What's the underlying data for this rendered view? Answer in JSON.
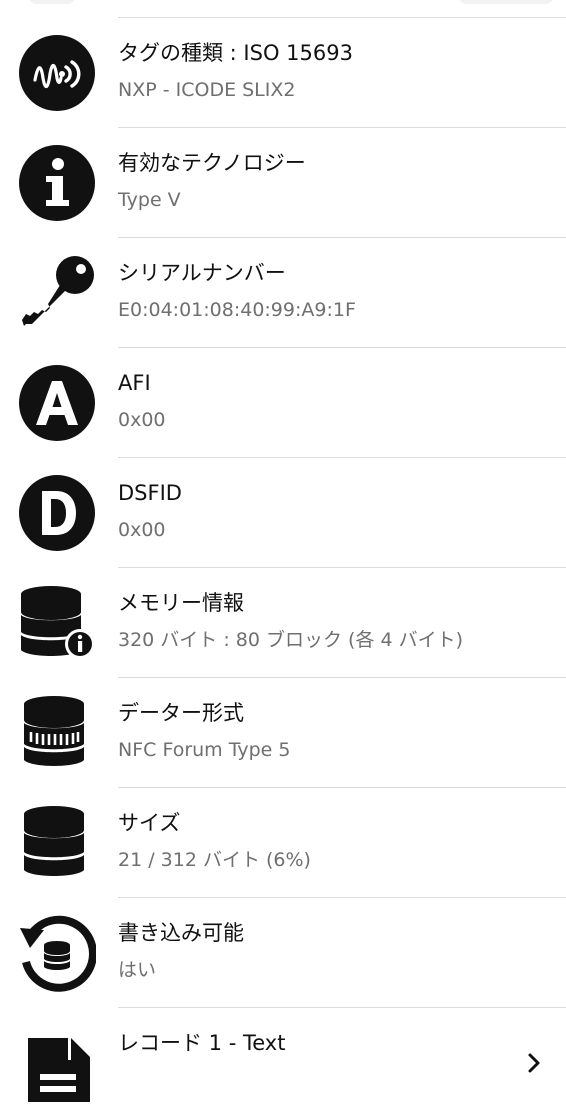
{
  "rows": [
    {
      "icon": "nfc-wave-icon",
      "title": "タグの種類 : ISO 15693",
      "value": "NXP - ICODE SLIX2"
    },
    {
      "icon": "info-icon",
      "title": "有効なテクノロジー",
      "value": "Type V"
    },
    {
      "icon": "key-icon",
      "title": "シリアルナンバー",
      "value": "E0:04:01:08:40:99:A9:1F"
    },
    {
      "icon": "letter-a-icon",
      "title": "AFI",
      "value": "0x00"
    },
    {
      "icon": "letter-d-icon",
      "title": "DSFID",
      "value": "0x00"
    },
    {
      "icon": "database-info-icon",
      "title": "メモリー情報",
      "value": "320 バイト : 80 ブロック (各 4 バイト)"
    },
    {
      "icon": "database-format-icon",
      "title": "データー形式",
      "value": "NFC Forum Type 5"
    },
    {
      "icon": "database-icon",
      "title": "サイズ",
      "value": "21 / 312 バイト (6%)"
    },
    {
      "icon": "writable-refresh-icon",
      "title": "書き込み可能",
      "value": "はい"
    },
    {
      "icon": "document-icon",
      "title": "レコード 1 - Text",
      "value": ""
    }
  ],
  "colors": {
    "icon": "#111111",
    "title": "#111111",
    "value": "#6f6f6f",
    "divider": "#dcdcdc"
  }
}
